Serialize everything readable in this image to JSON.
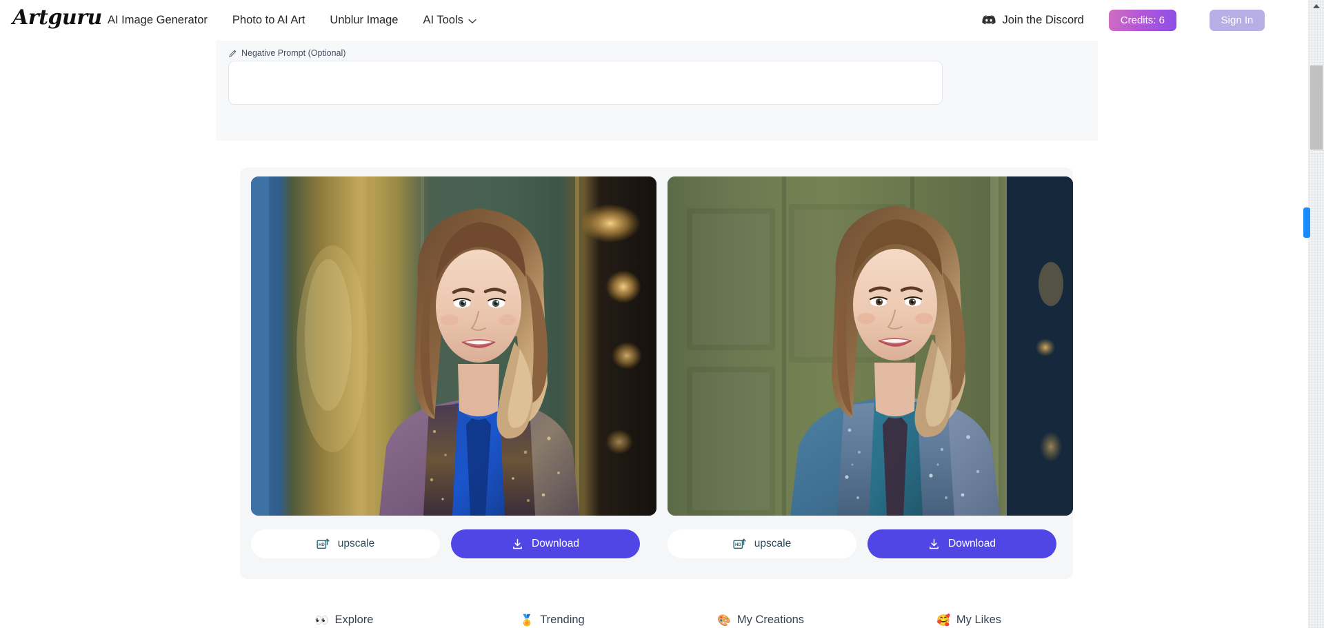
{
  "header": {
    "brand": "Artguru",
    "nav": [
      {
        "label": "AI Image Generator",
        "icon": null
      },
      {
        "label": "Photo to AI Art",
        "icon": null
      },
      {
        "label": "Unblur Image",
        "icon": null
      },
      {
        "label": "AI Tools",
        "icon": "chevron-down-icon"
      }
    ],
    "discord": {
      "label": "Join the Discord",
      "icon": "discord-icon"
    },
    "credits": {
      "label": "Credits: 6",
      "value": 6,
      "gradient_from": "#d06ec0",
      "gradient_to": "#8b4ee8"
    },
    "sign_in": {
      "label": "Sign In",
      "color": "#b7aee6"
    }
  },
  "prompt_panel": {
    "label": "Negative Prompt (Optional)",
    "label_icon": "pencil-icon",
    "textarea": {
      "value": "",
      "placeholder": ""
    }
  },
  "results": {
    "cards": [
      {
        "upscale_label": "upscale",
        "upscale_icon": "hd-upscale-icon",
        "download_label": "Download",
        "download_icon": "download-icon",
        "alt": "AI portrait of smiling woman with long brown hair in blue satin blouse and purple embellished jacket, ornate green and gold interior"
      },
      {
        "upscale_label": "upscale",
        "upscale_icon": "hd-upscale-icon",
        "download_label": "Download",
        "download_icon": "download-icon",
        "alt": "AI portrait of smiling woman with long brown hair in teal blouse and blue-grey embellished jacket, green panelled door background"
      }
    ],
    "accent": "#4f46e5"
  },
  "bottom_nav": [
    {
      "emoji": "👀",
      "label": "Explore",
      "icon": "eyes-icon"
    },
    {
      "emoji": "🏅",
      "label": "Trending",
      "icon": "medal-icon"
    },
    {
      "emoji": "🎨",
      "label": "My Creations",
      "icon": "palette-icon"
    },
    {
      "emoji": "🥰",
      "label": "My Likes",
      "icon": "smiling-face-hearts-icon"
    }
  ],
  "scrollbar": {
    "thumb_color": "#c1c1c1",
    "marker_color": "#1a8cff"
  }
}
